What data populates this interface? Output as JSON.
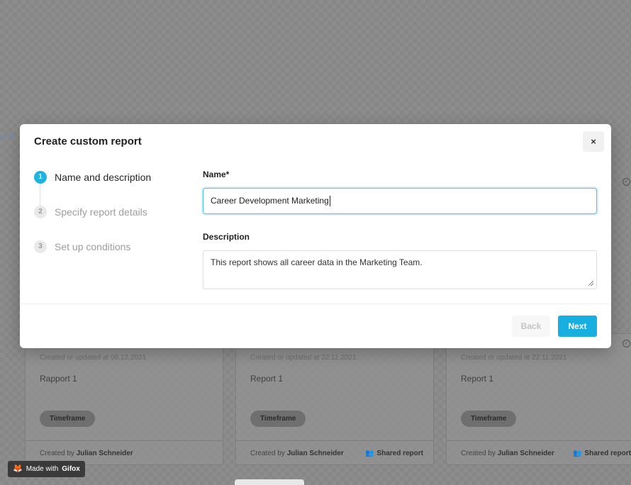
{
  "background": {
    "edge_text": "e filt",
    "cards": [
      {
        "meta": "Created or updated at 06.12.2021",
        "name": "Rapport 1",
        "tag": "Timeframe",
        "created_by_prefix": "Created by",
        "created_by": "Julian Schneider",
        "shared": ""
      },
      {
        "meta": "Created or updated at 22.11.2021",
        "name": "Report 1",
        "tag": "Timeframe",
        "created_by_prefix": "Created by",
        "created_by": "Julian Schneider",
        "shared": "Shared report"
      },
      {
        "meta": "Created or updated at 22.11.2021",
        "name": "Report 1",
        "tag": "Timeframe",
        "created_by_prefix": "Created by",
        "created_by": "Julian Schneider",
        "shared": "Shared report"
      }
    ],
    "watermark": {
      "prefix": "Made with",
      "brand": "Gifox"
    }
  },
  "modal": {
    "title": "Create custom report",
    "close_icon": "×",
    "steps": [
      {
        "number": "1",
        "label": "Name and description",
        "active": true
      },
      {
        "number": "2",
        "label": "Specify report details",
        "active": false
      },
      {
        "number": "3",
        "label": "Set up conditions",
        "active": false
      }
    ],
    "form": {
      "name_label": "Name*",
      "name_value": "Career Development Marketing",
      "description_label": "Description",
      "description_value": "This report shows all career data in the Marketing Team."
    },
    "buttons": {
      "back": "Back",
      "next": "Next"
    },
    "colors": {
      "accent": "#16afe0"
    }
  }
}
